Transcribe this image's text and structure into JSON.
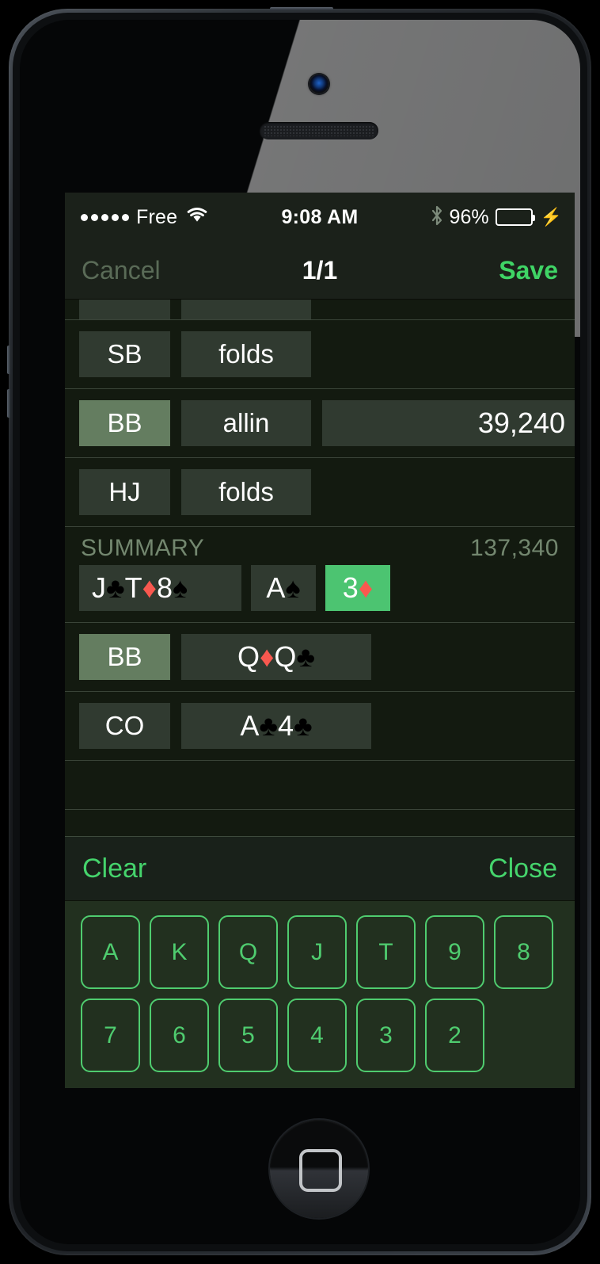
{
  "status_bar": {
    "signal_dots": 5,
    "carrier": "Free",
    "wifi_icon": "wifi-icon",
    "time": "9:08 AM",
    "bluetooth_icon": "bluetooth-icon",
    "battery_percent": "96%",
    "battery_level": 96,
    "charging_icon": "lightning-bolt-icon"
  },
  "nav_bar": {
    "cancel_label": "Cancel",
    "title": "1/1",
    "save_label": "Save"
  },
  "action_rows": [
    {
      "position": "",
      "action": "",
      "amount": "",
      "highlighted": false,
      "clipped": true
    },
    {
      "position": "SB",
      "action": "folds",
      "amount": "",
      "highlighted": false,
      "clipped": false
    },
    {
      "position": "BB",
      "action": "allin",
      "amount": "39,240",
      "highlighted": true,
      "clipped": false
    },
    {
      "position": "HJ",
      "action": "folds",
      "amount": "",
      "highlighted": false,
      "clipped": false
    }
  ],
  "summary": {
    "header_label": "SUMMARY",
    "pot_total": "137,340",
    "board": [
      {
        "group": "flop",
        "selected": false,
        "cards": [
          {
            "rank": "J",
            "suit": "♣",
            "color": "black"
          },
          {
            "rank": "T",
            "suit": "♦",
            "color": "red"
          },
          {
            "rank": "8",
            "suit": "♠",
            "color": "black"
          }
        ]
      },
      {
        "group": "turn",
        "selected": false,
        "cards": [
          {
            "rank": "A",
            "suit": "♠",
            "color": "black"
          }
        ]
      },
      {
        "group": "river",
        "selected": true,
        "cards": [
          {
            "rank": "3",
            "suit": "♦",
            "color": "red"
          }
        ]
      }
    ],
    "showdown": [
      {
        "position": "BB",
        "highlighted": true,
        "cards": [
          {
            "rank": "Q",
            "suit": "♦",
            "color": "red"
          },
          {
            "rank": "Q",
            "suit": "♣",
            "color": "black"
          }
        ]
      },
      {
        "position": "CO",
        "highlighted": false,
        "cards": [
          {
            "rank": "A",
            "suit": "♣",
            "color": "black"
          },
          {
            "rank": "4",
            "suit": "♣",
            "color": "black"
          }
        ]
      }
    ]
  },
  "keyboard_toolbar": {
    "clear_label": "Clear",
    "close_label": "Close"
  },
  "keypad": {
    "row1": [
      "A",
      "K",
      "Q",
      "J",
      "T",
      "9",
      "8"
    ],
    "row2": [
      "7",
      "6",
      "5",
      "4",
      "3",
      "2"
    ]
  },
  "colors": {
    "accent_green": "#3fd465",
    "key_green": "#4fcc6f",
    "selected_card_bg": "#4cc471",
    "red_suit": "#f9584f",
    "cell_bg": "#303a30",
    "cell_active_bg": "#647d60",
    "screen_bg": "#131a10"
  }
}
